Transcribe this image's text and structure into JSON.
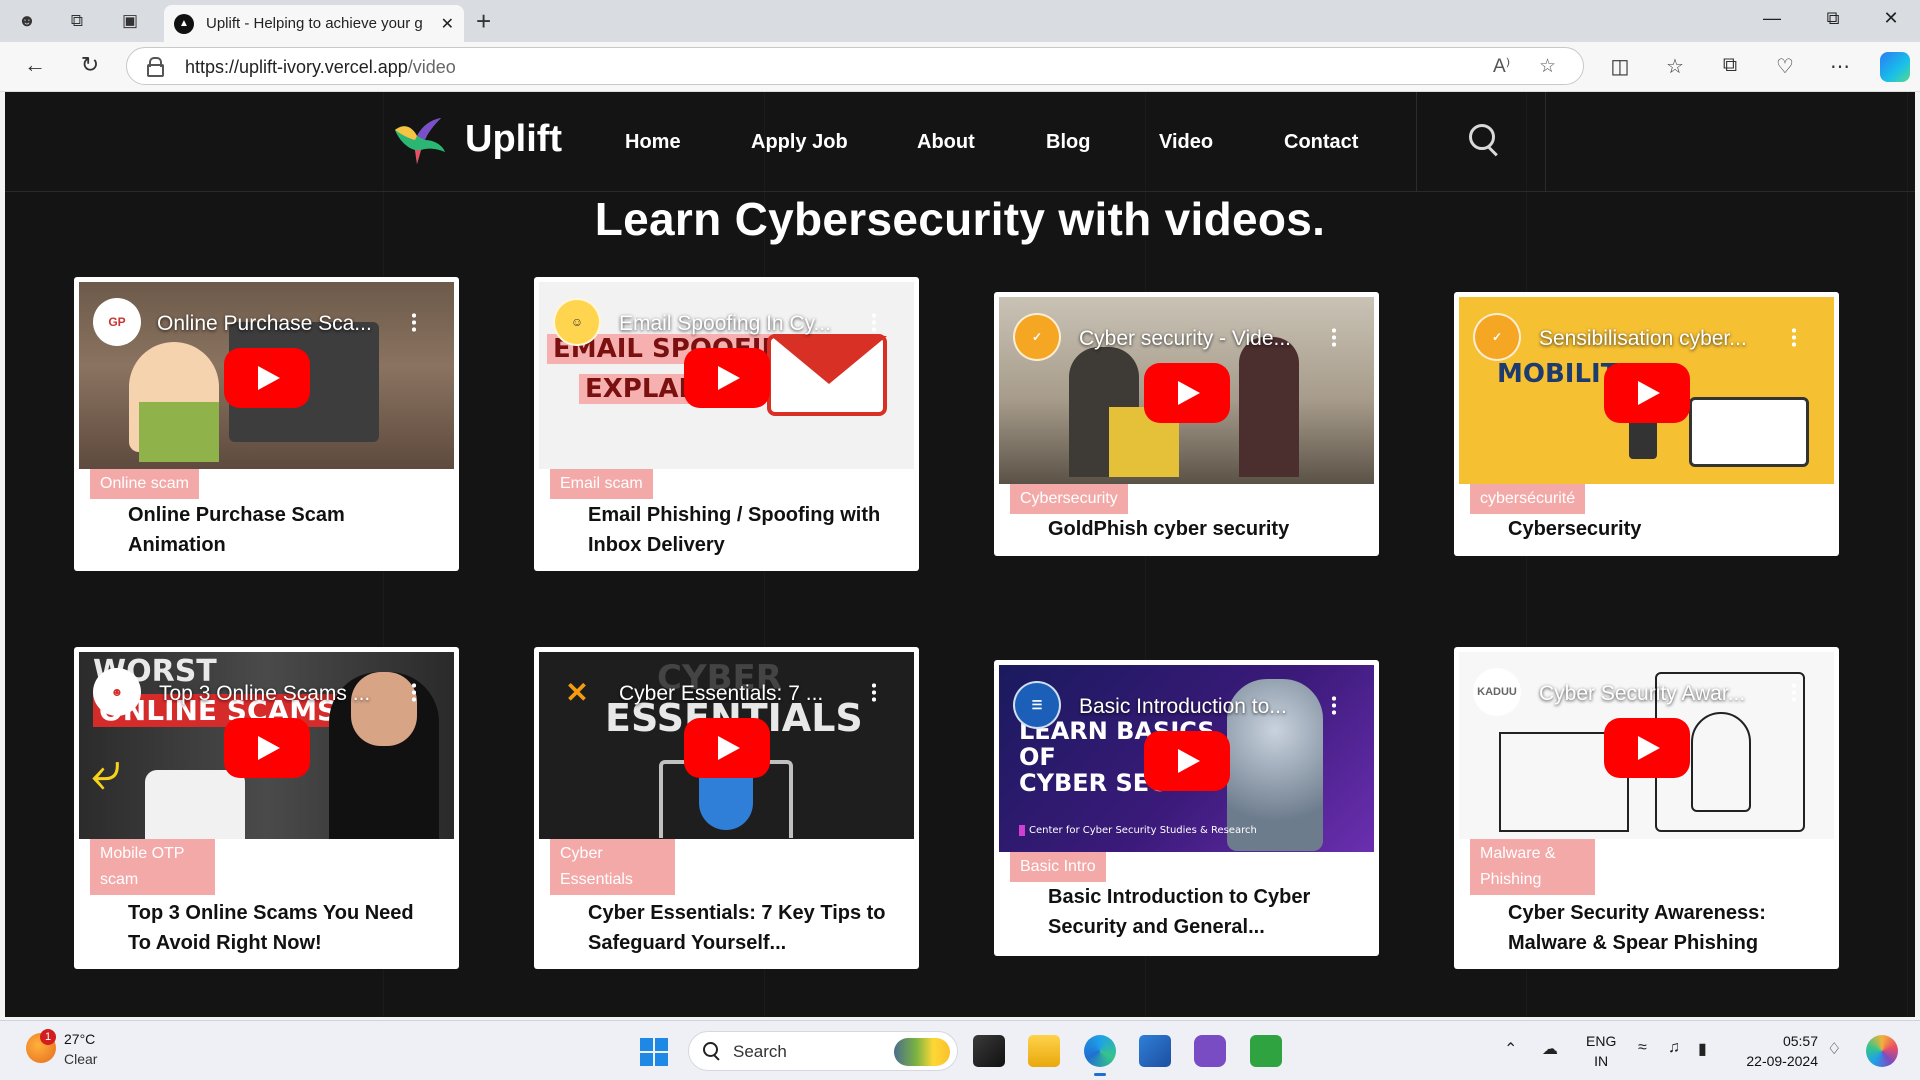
{
  "browser": {
    "tab_title": "Uplift - Helping to achieve your g",
    "url_host": "https://uplift-ivory.vercel.app",
    "url_path": "/video"
  },
  "site": {
    "brand": "Uplift",
    "nav": [
      "Home",
      "Apply Job",
      "About",
      "Blog",
      "Video",
      "Contact"
    ],
    "page_title": "Learn Cybersecurity with videos."
  },
  "videos": [
    {
      "thumb_title": "Online Purchase Sca...",
      "category": "Online scam",
      "title": "Online Purchase Scam Animation"
    },
    {
      "thumb_title": "Email Spoofing In Cy...",
      "category": "Email scam",
      "title": "Email Phishing / Spoofing with Inbox Delivery",
      "overlay_lines": [
        "EMAIL SPOOFING",
        "EXPLAINED"
      ]
    },
    {
      "thumb_title": "Cyber security - Vide...",
      "category": "Cybersecurity",
      "title": "GoldPhish cyber security"
    },
    {
      "thumb_title": "Sensibilisation cyber...",
      "category": "cybersécurité",
      "title": "Cybersecurity",
      "overlay_lines": [
        "MOBILITE"
      ]
    },
    {
      "thumb_title": "Top 3 Online Scams ...",
      "category": "Mobile OTP scam",
      "title": "Top 3 Online Scams You Need To Avoid Right Now!",
      "overlay_lines": [
        "WORST",
        "ONLINE SCAMS"
      ]
    },
    {
      "thumb_title": "Cyber Essentials: 7 ...",
      "category": "Cyber Essentials",
      "title": "Cyber Essentials: 7 Key Tips to Safeguard Yourself...",
      "overlay_lines": [
        "CYBER",
        "ESSENTIALS"
      ]
    },
    {
      "thumb_title": "Basic Introduction to...",
      "category": "Basic Intro",
      "title": "Basic Introduction to Cyber Security and General...",
      "overlay_lines": [
        "LEARN BASICS",
        "OF",
        "CYBER SEC",
        "Center for Cyber Security Studies & Research"
      ]
    },
    {
      "thumb_title": "Cyber Security Awar...",
      "category": "Malware & Phishing",
      "title": "Cyber Security Awareness: Malware & Spear Phishing",
      "channel": "KADUU"
    }
  ],
  "taskbar": {
    "weather_temp": "27°C",
    "weather_cond": "Clear",
    "weather_badge": "1",
    "search_placeholder": "Search",
    "lang": "ENG",
    "region": "IN",
    "time": "05:57",
    "date": "22-09-2024"
  },
  "colors": {
    "page_bg": "#141414",
    "badge": "#f4a9a9",
    "play": "#ff0000"
  }
}
